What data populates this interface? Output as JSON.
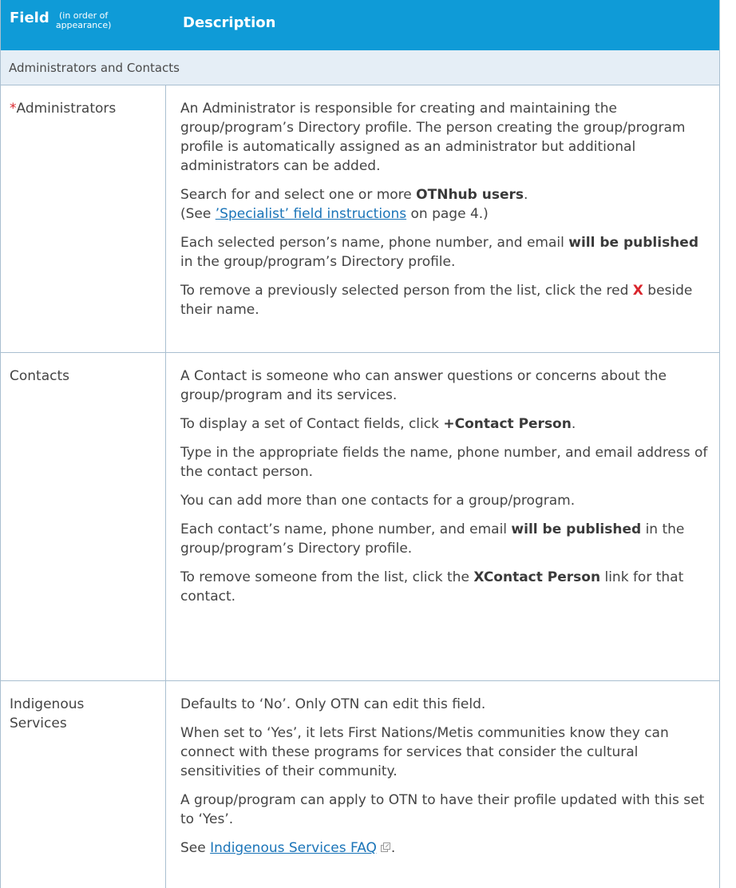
{
  "header": {
    "field_label": "Field",
    "field_sub_line1": "(in order of",
    "field_sub_line2": "appearance)",
    "description_label": "Description"
  },
  "section": {
    "title": "Administrators and Contacts"
  },
  "administrators": {
    "required_mark": "*",
    "field": "Administrators",
    "p1": "An Administrator is responsible for creating and maintaining the group/program’s Directory profile. The person creating the group/program profile is automatically assigned as an administrator but additional administrators can be added.",
    "p2_pre": "Search for and select one or more ",
    "p2_bold": "OTNhub users",
    "p2_post": ".",
    "p2_see_pre": "(See ",
    "p2_link": "’Specialist’ field instructions",
    "p2_see_post": " on page 4.)",
    "p3_pre": "Each selected person’s name, phone number, and email ",
    "p3_bold": "will be published",
    "p3_post": " in the group/program’s Directory profile.",
    "p4_pre": "To remove a previously selected person from the list, click the red ",
    "p4_x": "X",
    "p4_post": " beside their name."
  },
  "contacts": {
    "field": "Contacts",
    "p1": "A Contact is someone who can answer questions or concerns about the group/program and its services.",
    "p2_pre": "To display a set of Contact fields, click ",
    "p2_bold": "+Contact Person",
    "p2_post": ".",
    "p3": "Type in the appropriate fields the name, phone number, and email address of the contact person.",
    "p4": "You can add more than one contacts for a group/program.",
    "p5_pre": "Each contact’s name, phone number, and email ",
    "p5_bold": "will be published",
    "p5_post": " in the group/program’s Directory profile.",
    "p6_pre": "To remove someone from the list, click the ",
    "p6_bold": "XContact Person",
    "p6_post": " link for that contact."
  },
  "indigenous": {
    "field": "Indigenous Services",
    "p1": "Defaults to ‘No’. Only OTN can edit this field.",
    "p2": "When set to ‘Yes’, it lets First Nations/Metis communities know they can connect with these programs for services that consider the cultural sensitivities of their community.",
    "p3": "A group/program can apply to OTN to have their profile updated with this set to ‘Yes’.",
    "p4_pre": "See ",
    "p4_link": "Indigenous Services FAQ",
    "p4_post": "."
  },
  "colors": {
    "header_bg": "#0f9bd7",
    "section_bg": "#e5eef6",
    "border": "#a9bfd0",
    "required_red": "#d9262d",
    "link_blue": "#1a74b8"
  },
  "icons": {
    "external_link": "external-link-icon"
  }
}
